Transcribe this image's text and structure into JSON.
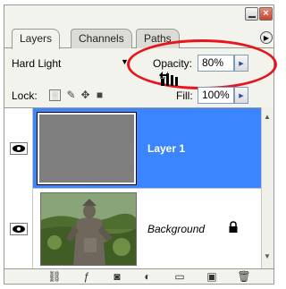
{
  "panel": {
    "tabs": [
      {
        "label": "Layers",
        "active": true
      },
      {
        "label": "Channels",
        "active": false
      },
      {
        "label": "Paths",
        "active": false
      }
    ],
    "menu_icon": "flyout-menu-icon",
    "close_glyph": "×"
  },
  "blend": {
    "mode": "Hard Light",
    "opacity_label": "Opacity:",
    "opacity_value": "80%"
  },
  "lock": {
    "label": "Lock:",
    "fill_label": "Fill:",
    "fill_value": "100%"
  },
  "layers": [
    {
      "name": "Layer 1",
      "selected": true,
      "visible": true
    },
    {
      "name": "Background",
      "selected": false,
      "visible": true,
      "locked": true
    }
  ],
  "colors": {
    "selection": "#3b86ff",
    "highlight_ellipse": "#e8161c"
  }
}
